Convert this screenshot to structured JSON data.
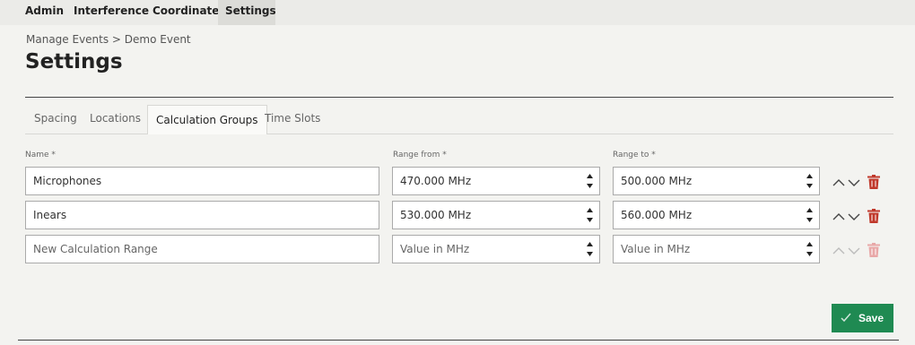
{
  "nav": {
    "items": [
      "Admin",
      "Interference",
      "Coordinate",
      "Settings"
    ],
    "active": "Settings"
  },
  "breadcrumb": "Manage Events > Demo Event",
  "page_title": "Settings",
  "tabs": [
    "Spacing",
    "Locations",
    "Calculation Groups",
    "Time Slots"
  ],
  "active_tab": "Calculation Groups",
  "columns": {
    "name": "Name *",
    "range_from": "Range from *",
    "range_to": "Range to *"
  },
  "rows": [
    {
      "name": "Microphones",
      "from": "470.000 MHz",
      "to": "500.000 MHz"
    },
    {
      "name": "Inears",
      "from": "530.000 MHz",
      "to": "560.000 MHz"
    }
  ],
  "new_row": {
    "name_placeholder": "New Calculation Range",
    "from_placeholder": "Value in MHz",
    "to_placeholder": "Value in MHz"
  },
  "save_label": "Save",
  "colors": {
    "accent": "#1f8a52",
    "delete": "#c0392b",
    "delete_disabled": "#e8a8a8"
  },
  "icons": {
    "move": [
      "chevron-up-icon",
      "chevron-down-icon"
    ],
    "delete": "trash-icon",
    "save": "check-icon",
    "spinner": "spinner-icon"
  }
}
